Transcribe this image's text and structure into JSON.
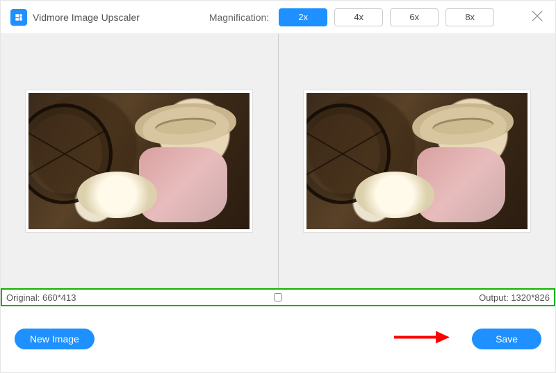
{
  "header": {
    "app_title": "Vidmore Image Upscaler",
    "magnification_label": "Magnification:",
    "options": [
      "2x",
      "4x",
      "6x",
      "8x"
    ],
    "selected_index": 0
  },
  "info": {
    "original_label": "Original:",
    "original_value": "660*413",
    "output_label": "Output:",
    "output_value": "1320*826"
  },
  "footer": {
    "new_image_label": "New Image",
    "save_label": "Save"
  },
  "colors": {
    "accent": "#1e90ff",
    "highlight_border": "#17b300",
    "arrow": "#ff0000"
  }
}
